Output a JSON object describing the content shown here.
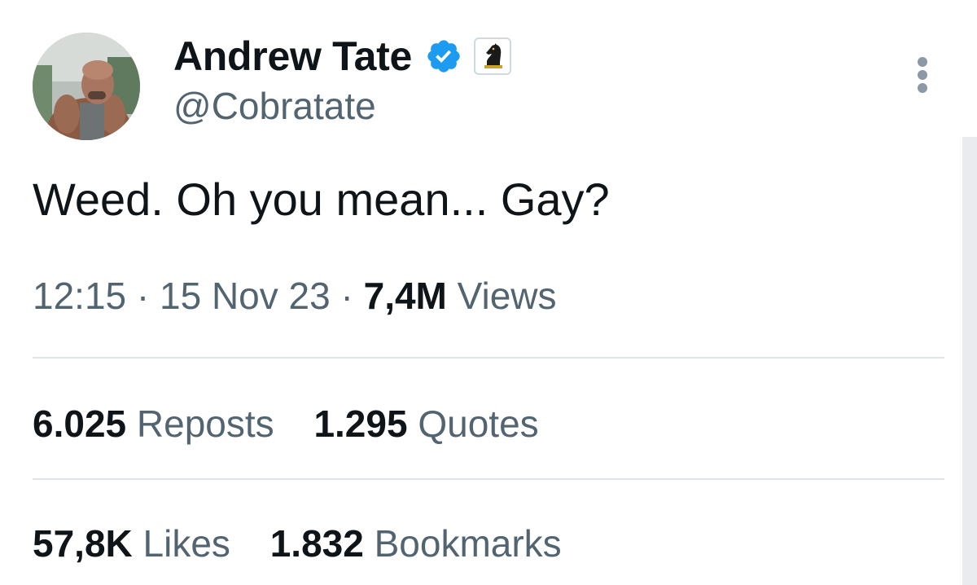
{
  "author": {
    "display_name": "Andrew Tate",
    "handle": "@Cobratate",
    "verified_badge_icon": "verified-check-icon",
    "affiliate_badge_icon": "chess-knight-icon",
    "verified_color": "#1d9bf0"
  },
  "post": {
    "text": "Weed. Oh you mean... Gay?",
    "time": "12:15",
    "date": "15 Nov 23",
    "separator": "·",
    "views_count": "7,4M",
    "views_label": "Views"
  },
  "stats": {
    "reposts_count": "6.025",
    "reposts_label": "Reposts",
    "quotes_count": "1.295",
    "quotes_label": "Quotes",
    "likes_count": "57,8K",
    "likes_label": "Likes",
    "bookmarks_count": "1.832",
    "bookmarks_label": "Bookmarks"
  },
  "menu": {
    "more_icon": "more-options-icon"
  }
}
